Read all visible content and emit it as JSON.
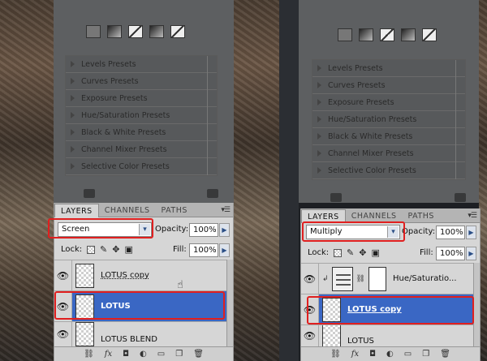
{
  "presets": [
    "Levels Presets",
    "Curves Presets",
    "Exposure Presets",
    "Hue/Saturation Presets",
    "Black & White Presets",
    "Channel Mixer Presets",
    "Selective Color Presets"
  ],
  "tabs": [
    "LAYERS",
    "CHANNELS",
    "PATHS"
  ],
  "menu_glyph": "▾☰",
  "left": {
    "blend_mode": "Screen",
    "opacity_label": "Opacity:",
    "opacity_value": "100%",
    "lock_label": "Lock:",
    "fill_label": "Fill:",
    "fill_value": "100%",
    "layers": [
      {
        "name": "LOTUS copy",
        "selected": false
      },
      {
        "name": "LOTUS",
        "selected": true
      },
      {
        "name": "LOTUS BLEND",
        "selected": false
      }
    ]
  },
  "right": {
    "blend_mode": "Multiply",
    "opacity_label": "Opacity:",
    "opacity_value": "100%",
    "lock_label": "Lock:",
    "fill_label": "Fill:",
    "fill_value": "100%",
    "layers": [
      {
        "name": "Hue/Saturatio...",
        "selected": false,
        "type": "adjustment"
      },
      {
        "name": "LOTUS copy",
        "selected": true
      },
      {
        "name": "LOTUS",
        "selected": false
      }
    ]
  },
  "bottom_icons": [
    "link-icon",
    "fx",
    "mask-icon",
    "adjustment-icon",
    "folder-icon",
    "new-layer-icon",
    "trash-icon"
  ],
  "fx_label": "fx",
  "colors": {
    "selection": "#3a67c4",
    "highlight": "#e01f1f",
    "panel": "#d6d6d6"
  }
}
